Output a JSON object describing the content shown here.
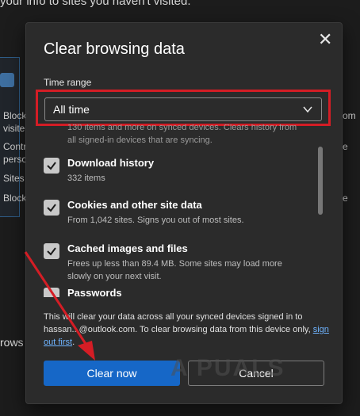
{
  "background": {
    "top_text": "your info to sites you haven't visited.",
    "left_lines": [
      "Block",
      "visite",
      "Contr",
      "perso",
      "Sites",
      "Block"
    ],
    "right_lines": [
      "om",
      "e",
      "e"
    ],
    "browse_text": "rows"
  },
  "dialog": {
    "title": "Clear browsing data",
    "time_range_label": "Time range",
    "time_range_value": "All time",
    "faded_line_1": "130 items and more on synced devices. Clears history from",
    "faded_line_2": "all signed-in devices that are syncing.",
    "items": [
      {
        "title": "Download history",
        "desc": "332 items",
        "checked": true
      },
      {
        "title": "Cookies and other site data",
        "desc": "From 1,042 sites. Signs you out of most sites.",
        "checked": true
      },
      {
        "title": "Cached images and files",
        "desc": "Frees up less than 89.4 MB. Some sites may load more slowly on your next visit.",
        "checked": true
      },
      {
        "title": "Passwords",
        "desc": "",
        "checked": false
      }
    ],
    "info_text": "This will clear your data across all your synced devices signed in to hassan...@outlook.com. To clear browsing data from this device only,",
    "info_link": "sign out first",
    "info_end": ".",
    "clear_button": "Clear now",
    "cancel_button": "Cancel"
  },
  "watermark": "A PUALS",
  "colors": {
    "accent": "#1667c7",
    "highlight": "#d41d25",
    "dialog_bg": "#2b2b2b"
  }
}
